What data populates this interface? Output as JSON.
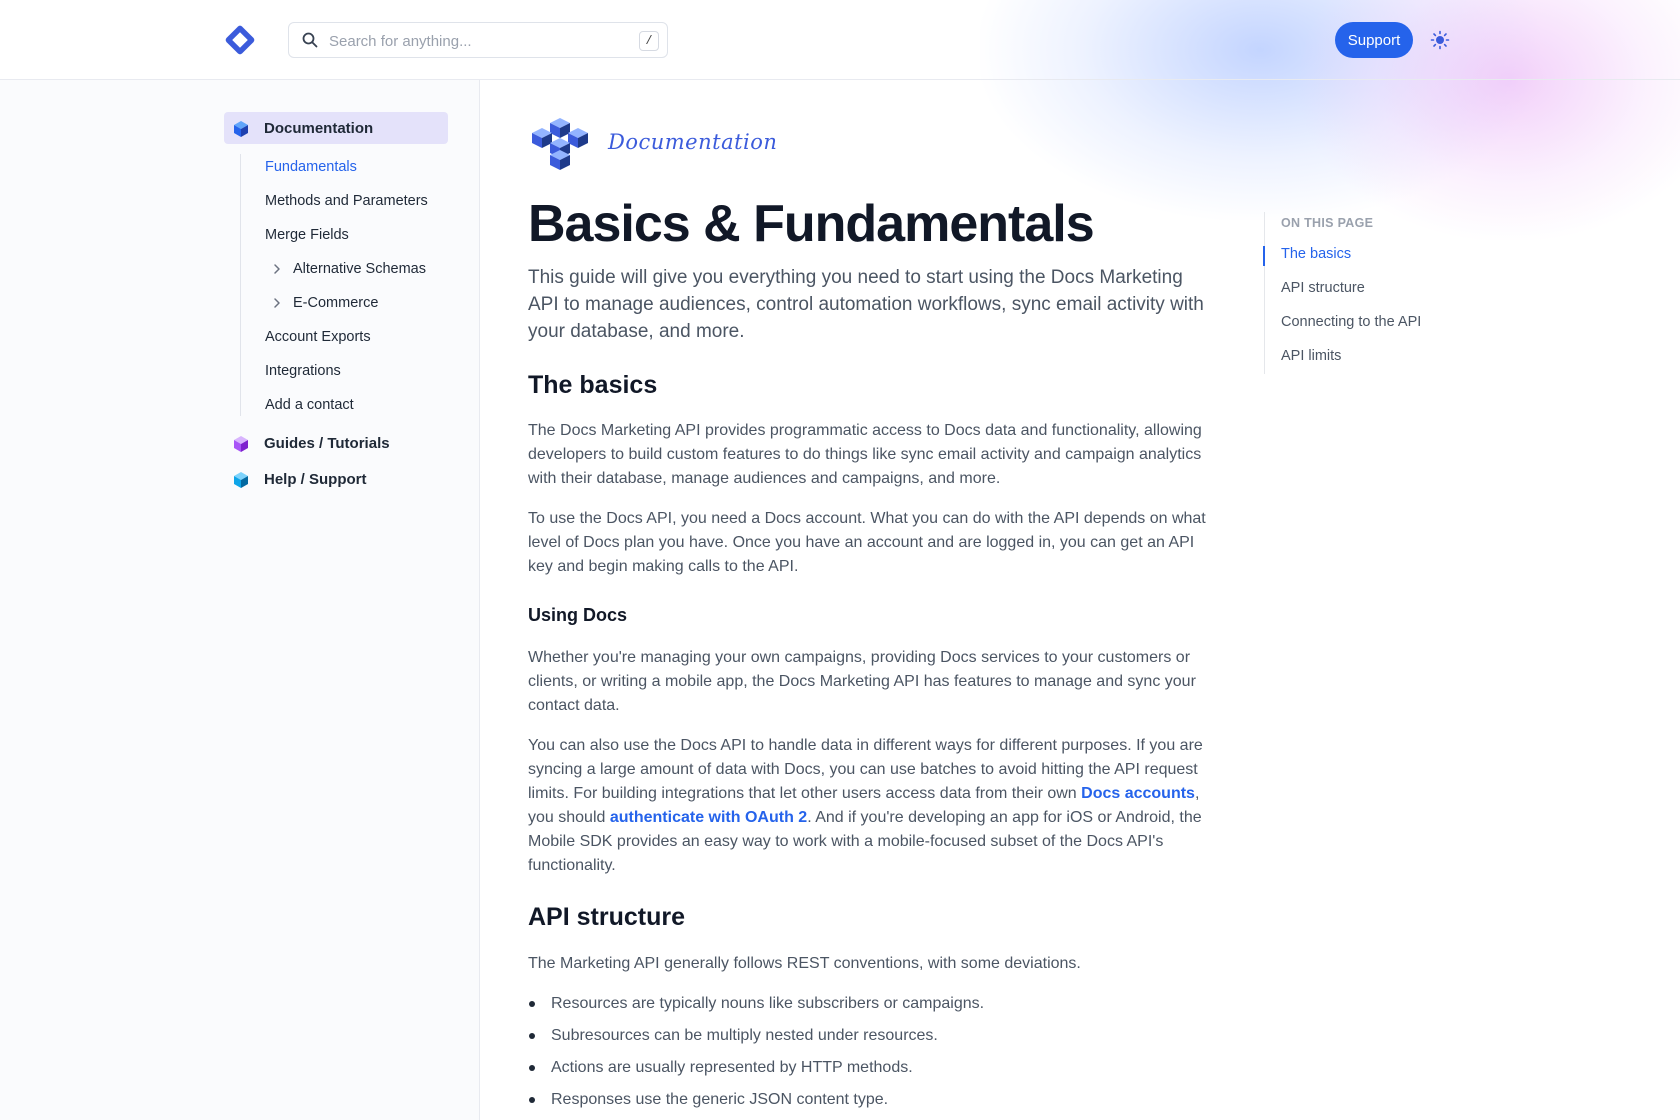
{
  "header": {
    "search_placeholder": "Search for anything...",
    "search_shortcut": "/",
    "support_label": "Support"
  },
  "sidebar": {
    "sections": [
      {
        "label": "Documentation",
        "active": true
      },
      {
        "label": "Guides / Tutorials",
        "active": false
      },
      {
        "label": "Help / Support",
        "active": false
      }
    ],
    "items": [
      {
        "label": "Fundamentals",
        "active": true
      },
      {
        "label": "Methods and Parameters"
      },
      {
        "label": "Merge Fields"
      },
      {
        "label": "Alternative Schemas",
        "expandable": true
      },
      {
        "label": "E-Commerce",
        "expandable": true
      },
      {
        "label": "Account Exports"
      },
      {
        "label": "Integrations"
      },
      {
        "label": "Add a contact"
      }
    ]
  },
  "main": {
    "brand": "Documentation",
    "title": "Basics & Fundamentals",
    "lead": "This guide will give you everything you need to start using the Docs Marketing API to manage audiences, control automation workflows, sync email activity with your database, and more.",
    "basics_heading": "The basics",
    "basics_p1": "The Docs Marketing API provides programmatic access to Docs data and functionality, allowing developers to build custom features to do things like sync email activity and campaign analytics with their database, manage audiences and campaigns, and more.",
    "basics_p2": "To use the Docs API, you need a Docs account. What you can do with the API depends on what level of Docs plan you have. Once you have an account and are logged in, you can get an API key and begin making calls to the API.",
    "using_heading": "Using Docs",
    "using_p1": "Whether you're managing your own campaigns, providing Docs services to your customers or clients, or writing a mobile app, the Docs Marketing API has features to manage and sync your contact data.",
    "using_p2_a": "You can also use the Docs API to handle data in different ways for different purposes. If you are syncing a large amount of data with Docs, you can use batches to avoid hitting the API request limits. For building integrations that let other users access data from their own ",
    "using_p2_link1": "Docs accounts",
    "using_p2_b": ", you should ",
    "using_p2_link2": "authenticate with OAuth 2",
    "using_p2_c": ". And if you're developing an app for iOS or Android, the Mobile SDK provides an easy way to work with a mobile-focused subset of the Docs API's functionality.",
    "api_heading": "API structure",
    "api_p1": "The Marketing API generally follows REST conventions, with some deviations.",
    "bullets": [
      "Resources are typically nouns like subscribers or campaigns.",
      "Subresources can be multiply nested under resources.",
      "Actions are usually represented by HTTP methods.",
      "Responses use the generic JSON content type."
    ]
  },
  "toc": {
    "heading": "ON THIS PAGE",
    "items": [
      "The basics",
      "API structure",
      "Connecting to the API",
      "API limits"
    ]
  },
  "colors": {
    "accent": "#2563eb",
    "active_section_bg": "#e4e2fa"
  }
}
